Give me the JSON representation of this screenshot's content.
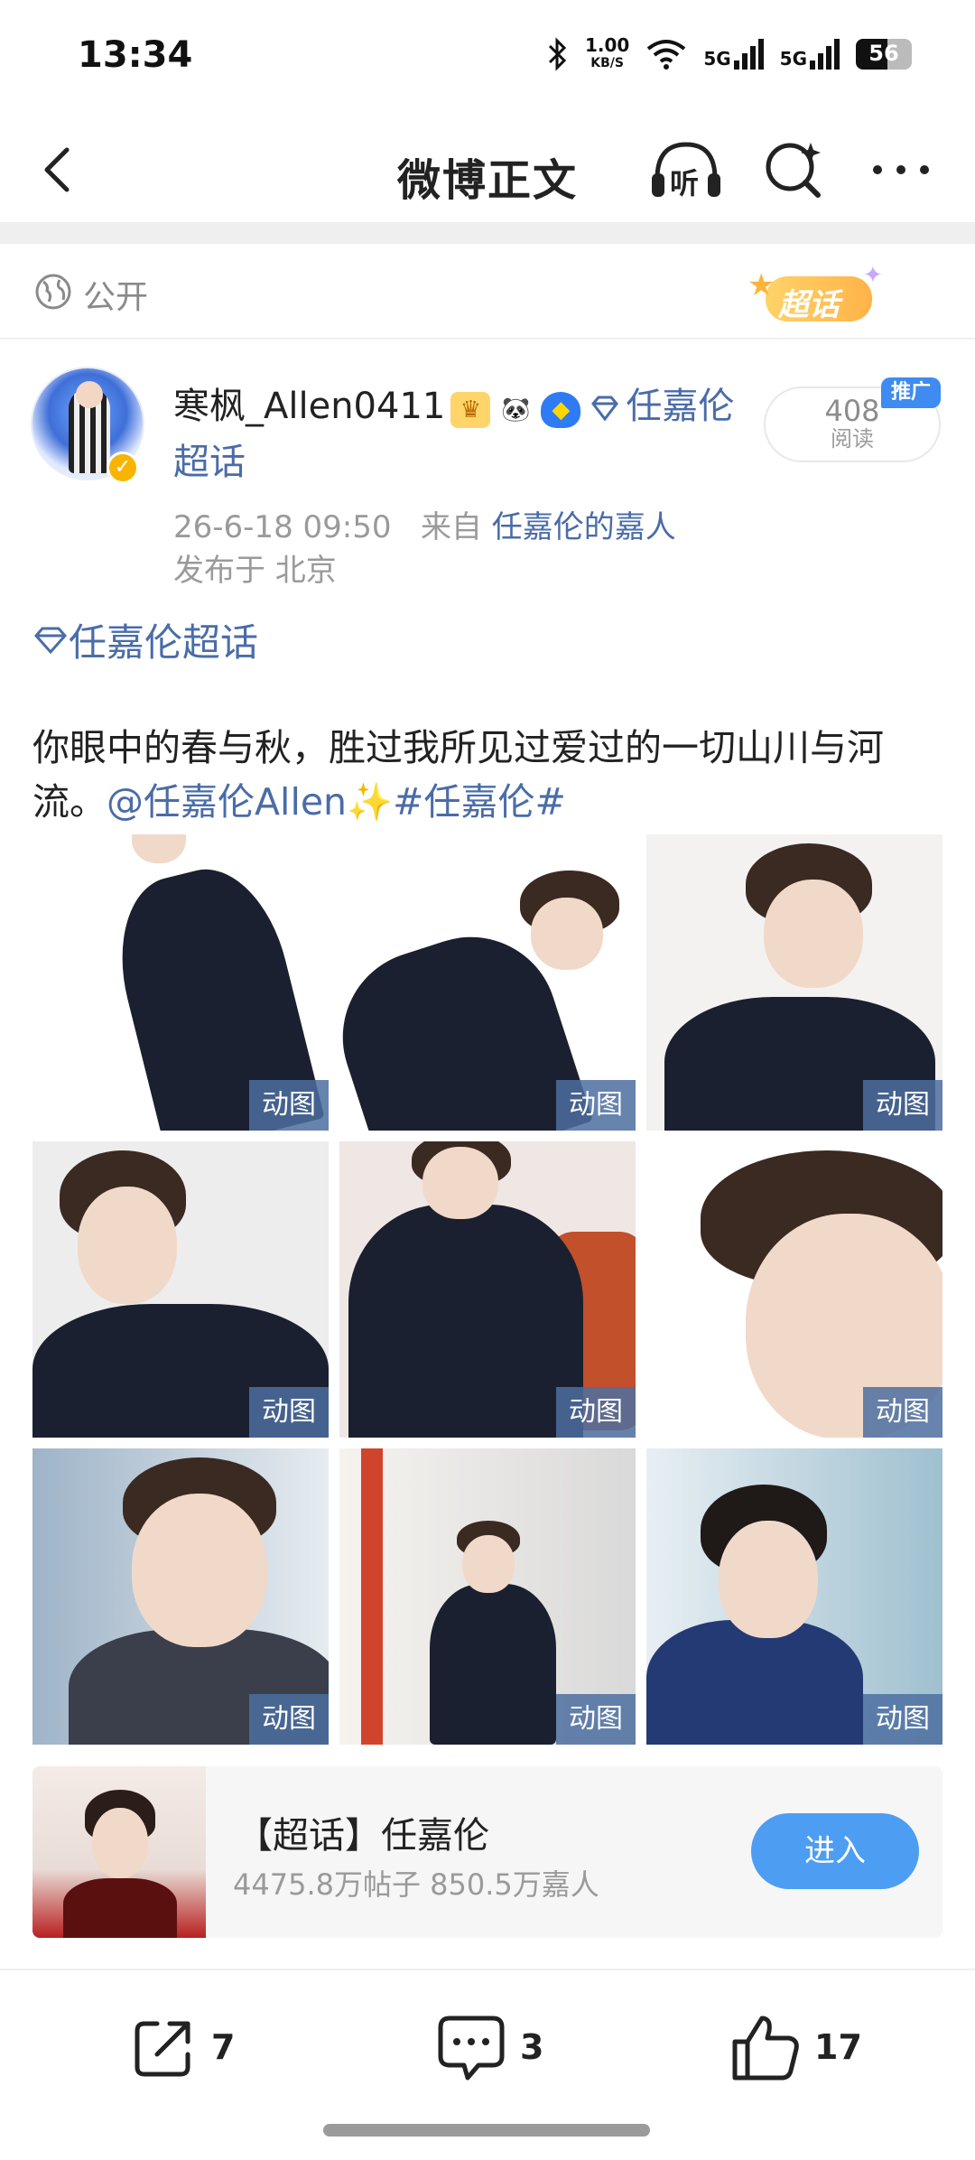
{
  "status_bar": {
    "time": "13:34",
    "net_speed_value": "1.00",
    "net_speed_unit": "KB/S",
    "signal1_label": "5G",
    "signal2_label": "5G",
    "battery_level": "56"
  },
  "header": {
    "title": "微博正文",
    "listen_label": "听"
  },
  "visibility": {
    "label": "公开",
    "topic_badge": "超话"
  },
  "post": {
    "author_name": "寒枫_Allen0411",
    "author_topic_link": "任嘉伦超话",
    "time": "26-6-18 09:50",
    "source_prefix": "来自",
    "source_name": "任嘉伦的嘉人",
    "location": "发布于 北京",
    "read_count": "408",
    "read_label": "阅读",
    "promo_tag": "推广",
    "topic_tag": "任嘉伦超话",
    "body_text": "你眼中的春与秋，胜过我所见过爱过的一切山川与河流。",
    "mention": "@任嘉伦Allen",
    "sparkle": "✨",
    "hashtag": "#任嘉伦#",
    "gif_label": "动图"
  },
  "super_topic_card": {
    "title": "【超话】任嘉伦",
    "stats": "4475.8万帖子 850.5万嘉人",
    "enter_label": "进入"
  },
  "actions": {
    "share_count": "7",
    "comment_count": "3",
    "like_count": "17"
  },
  "colors": {
    "link": "#4a6ca8",
    "enter_button": "#4d9df3",
    "gif_tag": "#4c6ea0",
    "promo_tag": "#3e8bf1"
  }
}
